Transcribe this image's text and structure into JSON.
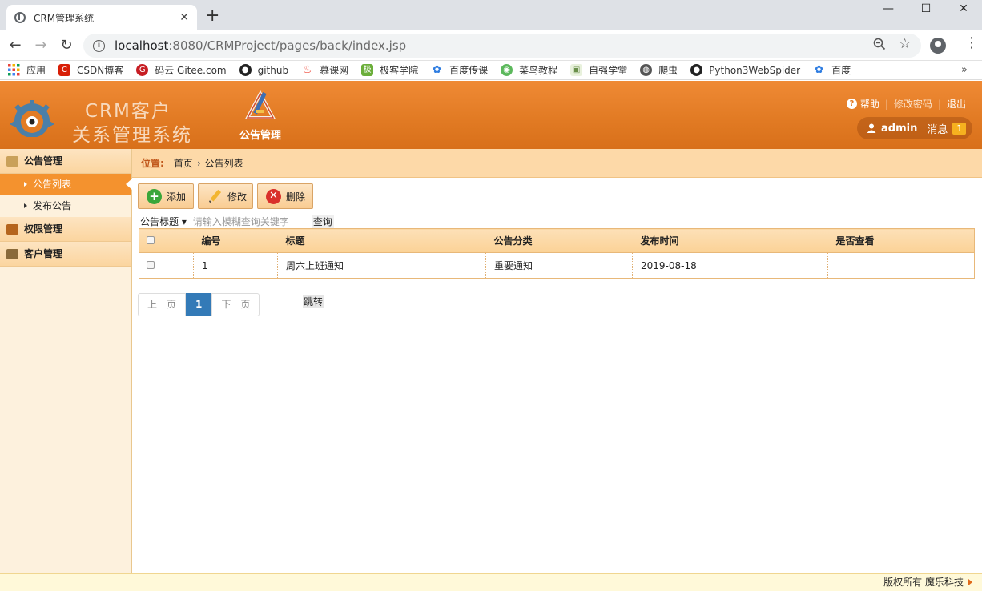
{
  "browser": {
    "tab_title": "CRM管理系统",
    "url_host": "localhost",
    "url_path": ":8080/CRMProject/pages/back/index.jsp",
    "bookmarks": [
      {
        "label": "应用",
        "icon": "apps-grid-icon",
        "color": "#e8453c"
      },
      {
        "label": "CSDN博客",
        "icon": "csdn-icon",
        "color": "#d81e06"
      },
      {
        "label": "码云 Gitee.com",
        "icon": "gitee-icon",
        "color": "#c71d23"
      },
      {
        "label": "github",
        "icon": "github-icon",
        "color": "#222222"
      },
      {
        "label": "慕课网",
        "icon": "flame-icon",
        "color": "#ef4b3b"
      },
      {
        "label": "极客学院",
        "icon": "jike-icon",
        "color": "#6bae3a"
      },
      {
        "label": "百度传课",
        "icon": "paw-icon",
        "color": "#2f7de1"
      },
      {
        "label": "菜鸟教程",
        "icon": "runoob-icon",
        "color": "#5cb85c"
      },
      {
        "label": "自强学堂",
        "icon": "ziqiang-icon",
        "color": "#8cb56a"
      },
      {
        "label": "爬虫",
        "icon": "globe-icon",
        "color": "#555555"
      },
      {
        "label": "Python3WebSpider",
        "icon": "github-icon",
        "color": "#222222"
      },
      {
        "label": "百度",
        "icon": "paw-icon",
        "color": "#2f7de1"
      }
    ]
  },
  "header": {
    "title_line1": "CRM客户",
    "title_line2": "关系管理系统",
    "module_label": "公告管理",
    "help": "帮助",
    "change_password": "修改密码",
    "logout": "退出",
    "username": "admin",
    "messages_label": "消息",
    "messages_count": "1"
  },
  "sidebar": {
    "groups": [
      {
        "label": "公告管理",
        "items": [
          "公告列表",
          "发布公告"
        ]
      },
      {
        "label": "权限管理"
      },
      {
        "label": "客户管理"
      }
    ]
  },
  "breadcrumb": {
    "label": "位置:",
    "home": "首页",
    "current": "公告列表"
  },
  "toolbar": {
    "add": "添加",
    "edit": "修改",
    "delete": "删除"
  },
  "search": {
    "field": "公告标题",
    "placeholder": "请输入模糊查询关键字",
    "button": "查询"
  },
  "table": {
    "columns": [
      "编号",
      "标题",
      "公告分类",
      "发布时间",
      "是否查看"
    ],
    "rows": [
      {
        "id": "1",
        "title": "周六上班通知",
        "category": "重要通知",
        "date": "2019-08-18",
        "viewed": ""
      }
    ]
  },
  "pagination": {
    "prev": "上一页",
    "current": "1",
    "next": "下一页",
    "jump": "跳转"
  },
  "footer": {
    "text": "版权所有 魔乐科技"
  }
}
